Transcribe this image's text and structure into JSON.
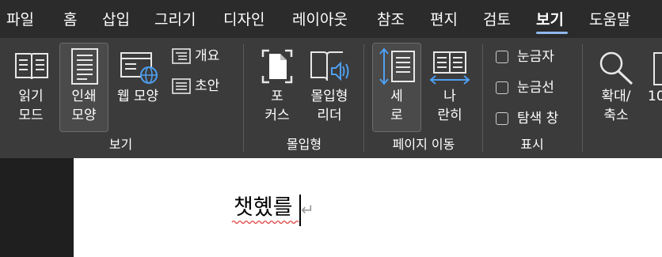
{
  "menu": {
    "tabs": [
      {
        "label": "파일"
      },
      {
        "label": "홈"
      },
      {
        "label": "삽입"
      },
      {
        "label": "그리기"
      },
      {
        "label": "디자인"
      },
      {
        "label": "레이아웃"
      },
      {
        "label": "참조"
      },
      {
        "label": "편지"
      },
      {
        "label": "검토"
      },
      {
        "label": "보기",
        "active": true
      },
      {
        "label": "도움말"
      }
    ]
  },
  "ribbon": {
    "views": {
      "group_label": "보기",
      "read_mode": {
        "line1": "읽기",
        "line2": "모드"
      },
      "print_layout": {
        "line1": "인쇄",
        "line2": "모양",
        "selected": true
      },
      "web_layout": {
        "label": "웹 모양"
      },
      "outline": {
        "label": "개요"
      },
      "draft": {
        "label": "초안"
      }
    },
    "immersive": {
      "group_label": "몰입형",
      "focus": {
        "line1": "포",
        "line2": "커스"
      },
      "immersive_reader": {
        "line1": "몰입형",
        "line2": "리더"
      }
    },
    "page_movement": {
      "group_label": "페이지 이동",
      "vertical": {
        "line1": "세",
        "line2": "로",
        "selected": true
      },
      "side_by_side": {
        "line1": "나",
        "line2": "란히"
      }
    },
    "show": {
      "group_label": "표시",
      "ruler": {
        "label": "눈금자",
        "checked": false
      },
      "gridlines": {
        "label": "눈금선",
        "checked": false
      },
      "navigation_pane": {
        "label": "탐색 창",
        "checked": false
      }
    },
    "zoom": {
      "zoom": {
        "line1": "확대/",
        "line2": "축소"
      },
      "hundred": {
        "label": "10"
      }
    }
  },
  "document": {
    "text": "챗혰를",
    "paragraph_mark": "↵"
  },
  "colors": {
    "menubar_bg": "#2b2b2b",
    "ribbon_bg": "#3b3b3b",
    "accent_blue": "#4f9ff0",
    "active_tab_underline": "#8fb8ef",
    "spell_squiggle": "#e04040"
  }
}
